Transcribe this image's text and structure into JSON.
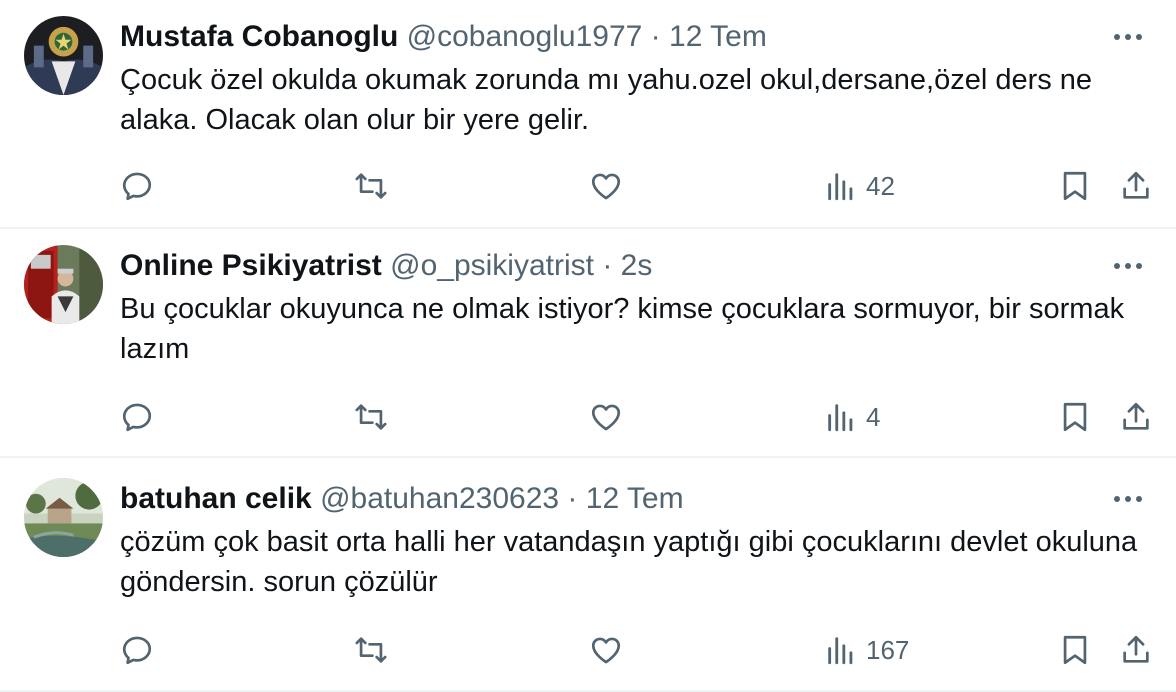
{
  "tweets": [
    {
      "name": "Mustafa Cobanoglu",
      "handle": "@cobanoglu1977",
      "separator": "·",
      "time": "12 Tem",
      "text": "Çocuk özel okulda okumak zorunda mı yahu.ozel okul,dersane,özel ders ne alaka. Olacak olan olur bir yere gelir.",
      "views": "42"
    },
    {
      "name": "Online Psikiyatrist",
      "handle": "@o_psikiyatrist",
      "separator": "·",
      "time": "2s",
      "text": "Bu çocuklar okuyunca ne olmak istiyor? kimse çocuklara sormuyor, bir sormak lazım",
      "views": "4"
    },
    {
      "name": "batuhan celik",
      "handle": "@batuhan230623",
      "separator": "·",
      "time": "12 Tem",
      "text": "çözüm çok basit orta halli her vatandaşın yaptığı gibi çocuklarını devlet okuluna göndersin. sorun çözülür",
      "views": "167"
    }
  ],
  "icons": {
    "reply": "reply-icon",
    "retweet": "retweet-icon",
    "like": "like-icon",
    "views": "views-icon",
    "bookmark": "bookmark-icon",
    "share": "share-icon",
    "more": "more-icon"
  },
  "colors": {
    "text": "#0f1419",
    "secondary": "#536471",
    "divider": "#eff3f4"
  }
}
